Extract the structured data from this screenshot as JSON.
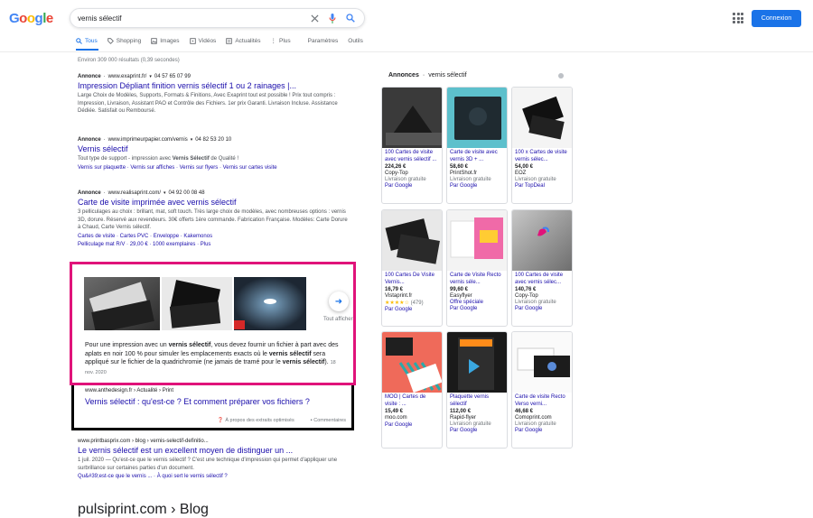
{
  "header": {
    "logo": "Google",
    "query": "vernis sélectif",
    "connect": "Connexion"
  },
  "tabs": [
    "Tous",
    "Shopping",
    "Images",
    "Vidéos",
    "Actualités",
    "Plus",
    "Paramètres",
    "Outils"
  ],
  "stats": "Environ 309 000 résultats (0,39 secondes)",
  "results": [
    {
      "label": "Annonce",
      "url": "www.exaprint.fr/",
      "phone": "04 57 65 07 99",
      "title": "Impression Dépliant finition vernis sélectif 1 ou 2 rainages |...",
      "snippet": "Large Choix de Modèles, Supports, Formats & Finitions, Avec Exaprint tout est possible ! Prix tout compris : Impression, Livraison, Assistant PAO et Contrôle des Fichiers. 1er prix Garanti. Livraison Incluse. Assistance Dédiée. Satisfait ou Remboursé."
    },
    {
      "label": "Annonce",
      "url": "www.imprimeurpapier.com/vernis",
      "phone": "04 82 53 20 10",
      "title": "Vernis sélectif",
      "snippet_pre": "Tout type de support - impression avec ",
      "snippet_bold": "Vernis Sélectif",
      "snippet_post": " de Qualité !",
      "links": "Vernis sur plaquette · Vernis sur affiches · Vernis sur flyers · Vernis sur cartes visite"
    },
    {
      "label": "Annonce",
      "url": "www.realisaprint.com/",
      "phone": "04 92 00 08 48",
      "title": "Carte de visite imprimée avec vernis sélectif",
      "snippet": "3 pelliculages au choix : brillant, mat, soft touch. Très large choix de modèles, avec nombreuses options : vernis 3D, dorure. Réservé aux revendeurs. 30€ offerts 1ère commande. Fabrication Française. Modèles: Carte Dorure à Chaud, Carte Vernis sélectif.",
      "links1": "Cartes de visite · Cartes PVC · Enveloppe · Kakemonos",
      "links2": "Pelliculage mat R/V · 29,00 € · 1000 exemplaires · Plus"
    }
  ],
  "featured": {
    "text_pre": "Pour une impression avec un ",
    "b1": "vernis sélectif",
    "text_mid1": ", vous devez fournir un fichier à part avec des aplats en noir 100 % pour simuler les emplacements exacts où le ",
    "b2": "vernis sélectif",
    "text_mid2": " sera appliqué sur le fichier de la quadrichromie (ne jamais de tramé pour le ",
    "b3": "vernis sélectif",
    "text_post": ").",
    "date": "18 nov. 2020",
    "more": "Tout afficher",
    "source": "www.anthedesign.fr › Actualité › Print",
    "title": "Vernis sélectif : qu'est-ce ? Et comment préparer vos fichiers ?",
    "about": "À propos des extraits optimisés",
    "comments": "Commentaires"
  },
  "organic": {
    "url": "www.printbasprix.com › blog › vernis-selectif-definitio...",
    "title": "Le vernis sélectif est un excellent moyen de distinguer un ...",
    "snippet": "1 juil. 2020 — Qu'est-ce que le vernis sélectif ? C'est une technique d'impression qui permet d'appliquer une surbrillance sur certaines parties d'un document.",
    "links": "Qu&#39;est-ce que le vernis ... · À quoi sert le vernis sélectif ?",
    "next_url": "pulsiprint.com › Blog"
  },
  "ads": {
    "label": "Annonces",
    "query": "vernis sélectif",
    "products": [
      {
        "name": "100 Cartes de visite avec vernis sélectif ...",
        "price": "224,26 €",
        "seller": "Copy-Top",
        "ship": "Livraison gratuite",
        "by": "Par Google"
      },
      {
        "name": "Carte de visite avec vernis 3D + ...",
        "price": "58,60 €",
        "seller": "PrintShot.fr",
        "ship": "Livraison gratuite",
        "by": "Par Google"
      },
      {
        "name": "100 x Cartes de visite vernis sélec...",
        "price": "54,00 €",
        "seller": "EOZ",
        "ship": "Livraison gratuite",
        "by": "Par TopDeal"
      },
      {
        "name": "100 Cartes De Visite Vernis...",
        "price": "16,79 €",
        "seller": "Vistaprint.fr",
        "stars": "★★★★☆",
        "count": "(479)",
        "by": "Par Google"
      },
      {
        "name": "Carte de Visite Recto vernis séle...",
        "price": "99,60 €",
        "seller": "Easyflyer",
        "ship": "Offre spéciale",
        "by": "Par Google"
      },
      {
        "name": "100 Cartes de visite avec vernis sélec...",
        "price": "140,76 €",
        "seller": "Copy-Top",
        "ship": "Livraison gratuite",
        "by": "Par Google"
      },
      {
        "name": "MOO | Cartes de visite : ...",
        "price": "15,49 €",
        "seller": "moo.com",
        "by": "Par Google"
      },
      {
        "name": "Plaquette vernis sélectif",
        "price": "112,00 €",
        "seller": "Rapid-flyer",
        "ship": "Livraison gratuite",
        "by": "Par Google"
      },
      {
        "name": "Carte de visite Recto Verso verni...",
        "price": "46,68 €",
        "seller": "Comoprint.com",
        "ship": "Livraison gratuite",
        "by": "Par Google"
      }
    ]
  },
  "colors": {
    "link": "#1a0dab",
    "accent": "#1a73e8",
    "highlight": "#e0137a"
  }
}
